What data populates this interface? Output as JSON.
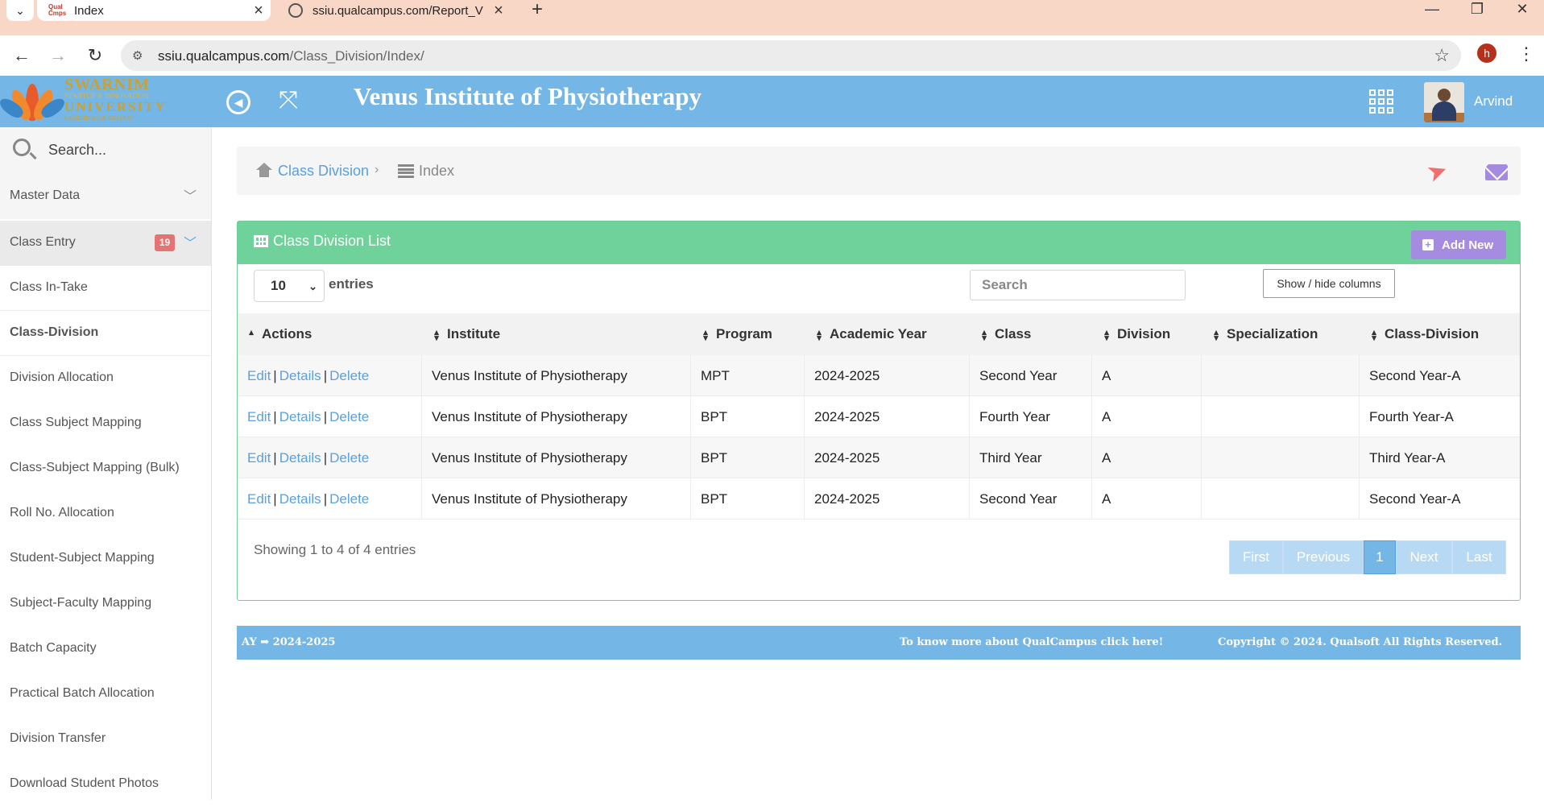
{
  "browser": {
    "tabs": [
      {
        "title": "Index",
        "favicon_text": "QualCampus",
        "active": true
      },
      {
        "title": "ssiu.qualcampus.com/Report_V",
        "active": false
      }
    ],
    "url_host": "ssiu.qualcampus.com",
    "url_path": "/Class_Division/Index/",
    "profile_initial": "h"
  },
  "header": {
    "logo_line1": "SWARNIM",
    "logo_line2": "STARTUP & INNOVATION",
    "logo_line3": "UNIVERSITY",
    "logo_line4": "GANDHINAGAR GUJARAT",
    "title": "Venus Institute of Physiotherapy",
    "user_name": "Arvind",
    "accent": "#74b6e6"
  },
  "sidebar": {
    "search_placeholder": "Search...",
    "groups": [
      {
        "label": "Master Data"
      },
      {
        "label": "Class Entry",
        "badge": "19"
      }
    ],
    "items": [
      {
        "label": "Class In-Take"
      },
      {
        "label": "Class-Division",
        "active": true
      },
      {
        "label": "Division Allocation"
      },
      {
        "label": "Class Subject Mapping"
      },
      {
        "label": "Class-Subject Mapping (Bulk)"
      },
      {
        "label": "Roll No. Allocation"
      },
      {
        "label": "Student-Subject Mapping"
      },
      {
        "label": "Subject-Faculty Mapping"
      },
      {
        "label": "Batch Capacity"
      },
      {
        "label": "Practical Batch Allocation"
      },
      {
        "label": "Division Transfer"
      },
      {
        "label": "Download Student Photos"
      }
    ]
  },
  "breadcrumb": {
    "parent": "Class Division",
    "current": "Index"
  },
  "panel": {
    "title": "Class Division List",
    "add_new_label": "Add New",
    "page_length": "10",
    "entries_label": "entries",
    "search_placeholder": "Search",
    "colvis_label": "Show / hide columns",
    "columns": [
      "Actions",
      "Institute",
      "Program",
      "Academic Year",
      "Class",
      "Division",
      "Specialization",
      "Class-Division"
    ],
    "action_labels": {
      "edit": "Edit",
      "details": "Details",
      "delete": "Delete",
      "sep": "|"
    },
    "rows": [
      {
        "institute": "Venus Institute of Physiotherapy",
        "program": "MPT",
        "academic_year": "2024-2025",
        "class": "Second Year",
        "division": "A",
        "specialization": "",
        "class_division": "Second Year-A"
      },
      {
        "institute": "Venus Institute of Physiotherapy",
        "program": "BPT",
        "academic_year": "2024-2025",
        "class": "Fourth Year",
        "division": "A",
        "specialization": "",
        "class_division": "Fourth Year-A"
      },
      {
        "institute": "Venus Institute of Physiotherapy",
        "program": "BPT",
        "academic_year": "2024-2025",
        "class": "Third Year",
        "division": "A",
        "specialization": "",
        "class_division": "Third Year-A"
      },
      {
        "institute": "Venus Institute of Physiotherapy",
        "program": "BPT",
        "academic_year": "2024-2025",
        "class": "Second Year",
        "division": "A",
        "specialization": "",
        "class_division": "Second Year-A"
      }
    ],
    "info": "Showing 1 to 4 of 4 entries",
    "pager": {
      "first": "First",
      "previous": "Previous",
      "current": "1",
      "next": "Next",
      "last": "Last"
    }
  },
  "footer": {
    "ay_label": "AY",
    "ay_value": "2024-2025",
    "more_link": "To know more about QualCampus click here!",
    "copyright": "Copyright © 2024. Qualsoft All Rights Reserved."
  }
}
